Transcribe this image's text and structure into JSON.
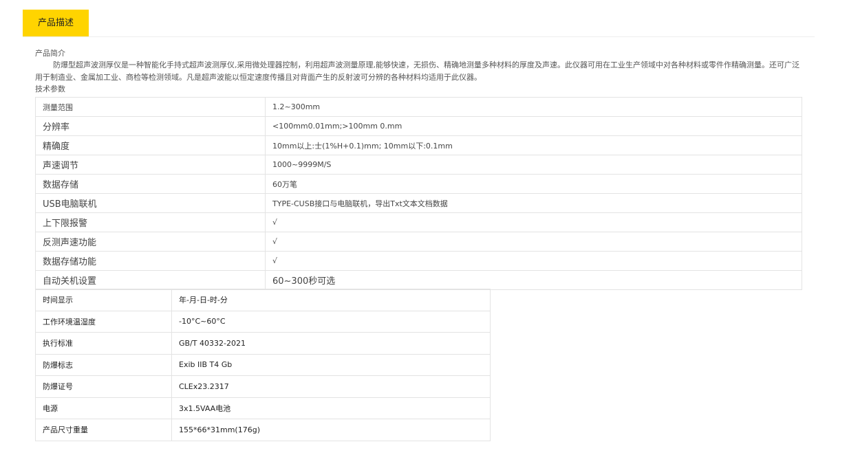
{
  "tabs": {
    "active_label": "产品描述"
  },
  "intro": {
    "heading": "产品简介",
    "text": "防爆型超声波测厚仪是一种智能化手持式超声波测厚仪,采用微处理器控制，利用超声波测量原理,能够快速，无损伤、精确地测量多种材料的厚度及声速。此仪器可用在工业生产领域中对各种材料或零件作精确测量。还可广泛用于制造业、金属加工业、商检等检测领域。凡是超声波能以恒定速度传播且对背面产生的反射波可分辨的各种材料均适用于此仪器。"
  },
  "tech_heading": "技术参数",
  "spec_table_1": [
    {
      "key": "测量范围",
      "value": "1.2~300mm"
    },
    {
      "key": "分辨率",
      "value": "<100mm0.01mm;>100mm 0.mm"
    },
    {
      "key": "精确度",
      "value": "10mm以上:士(1%H+0.1)mm; 10mm以下:0.1mm"
    },
    {
      "key": "声速调节",
      "value": "1000~9999M/S"
    },
    {
      "key": "数据存储",
      "value": "60万笔"
    },
    {
      "key": "USB电脑联机",
      "value": "TYPE-CUSB接口与电脑联机，导出Txt文本文档数据"
    },
    {
      "key": "上下限报警",
      "value": "√"
    },
    {
      "key": "反测声速功能",
      "value": "√"
    },
    {
      "key": "数据存储功能",
      "value": "√"
    },
    {
      "key": "自动关机设置",
      "value": "60~300秒可选"
    }
  ],
  "spec_table_2": [
    {
      "key": "时间显示",
      "value": "年-月-日-时-分"
    },
    {
      "key": "工作环境温湿度",
      "value": "-10°C~60°C"
    },
    {
      "key": "执行标准",
      "value": "GB/T 40332-2021"
    },
    {
      "key": "防爆标志",
      "value": "Exib IIB T4 Gb"
    },
    {
      "key": "防爆证号",
      "value": "CLEx23.2317"
    },
    {
      "key": "电源",
      "value": "3x1.5VAA电池"
    },
    {
      "key": "产品尺寸重量",
      "value": "155*66*31mm(176g)"
    }
  ]
}
